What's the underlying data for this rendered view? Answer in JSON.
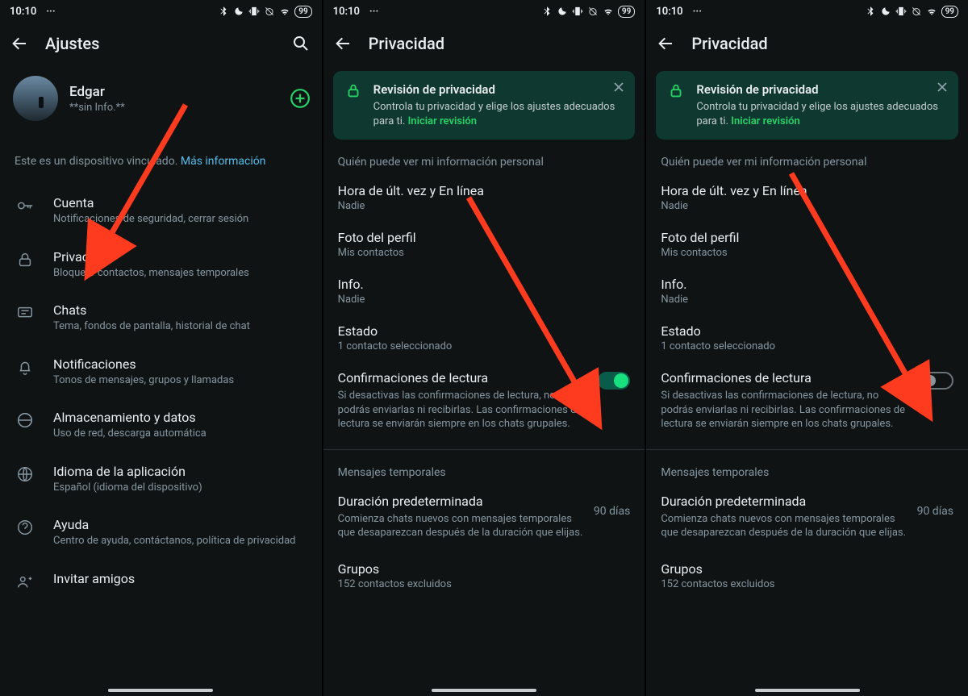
{
  "status": {
    "time": "10:10",
    "battery": "99"
  },
  "screen1": {
    "title": "Ajustes",
    "profile": {
      "name": "Edgar",
      "status": "**sin Info.**"
    },
    "linked_text": "Este es un dispositivo vinculado. ",
    "linked_link": "Más información",
    "items": [
      {
        "title": "Cuenta",
        "sub": "Notificaciones de seguridad, cerrar sesión"
      },
      {
        "title": "Privacidad",
        "sub": "Bloquear contactos, mensajes temporales"
      },
      {
        "title": "Chats",
        "sub": "Tema, fondos de pantalla, historial de chat"
      },
      {
        "title": "Notificaciones",
        "sub": "Tonos de mensajes, grupos y llamadas"
      },
      {
        "title": "Almacenamiento y datos",
        "sub": "Uso de red, descarga automática"
      },
      {
        "title": "Idioma de la aplicación",
        "sub": "Español (idioma del dispositivo)"
      },
      {
        "title": "Ayuda",
        "sub": "Centro de ayuda, contáctanos, política de privacidad"
      },
      {
        "title": "Invitar amigos",
        "sub": ""
      }
    ]
  },
  "privacy": {
    "title": "Privacidad",
    "banner_title": "Revisión de privacidad",
    "banner_body": "Controla tu privacidad y elige los ajustes adecuados para ti. ",
    "banner_link": "Iniciar revisión",
    "section_personal": "Quién puede ver mi información personal",
    "rows": {
      "last_seen_t": "Hora de últ. vez y En línea",
      "last_seen_v": "Nadie",
      "photo_t": "Foto del perfil",
      "photo_v": "Mis contactos",
      "info_t": "Info.",
      "info_v": "Nadie",
      "status_t": "Estado",
      "status_v": "1 contacto seleccionado",
      "read_t": "Confirmaciones de lectura",
      "read_desc": "Si desactivas las confirmaciones de lectura, no podrás enviarlas ni recibirlas. Las confirmaciones de lectura se enviarán siempre en los chats grupales."
    },
    "section_temp": "Mensajes temporales",
    "duration_t": "Duración predeterminada",
    "duration_desc": "Comienza chats nuevos con mensajes temporales que desaparezcan después de la duración que elijas.",
    "duration_v": "90 días",
    "groups_t": "Grupos",
    "groups_v": "152 contactos excluidos"
  }
}
